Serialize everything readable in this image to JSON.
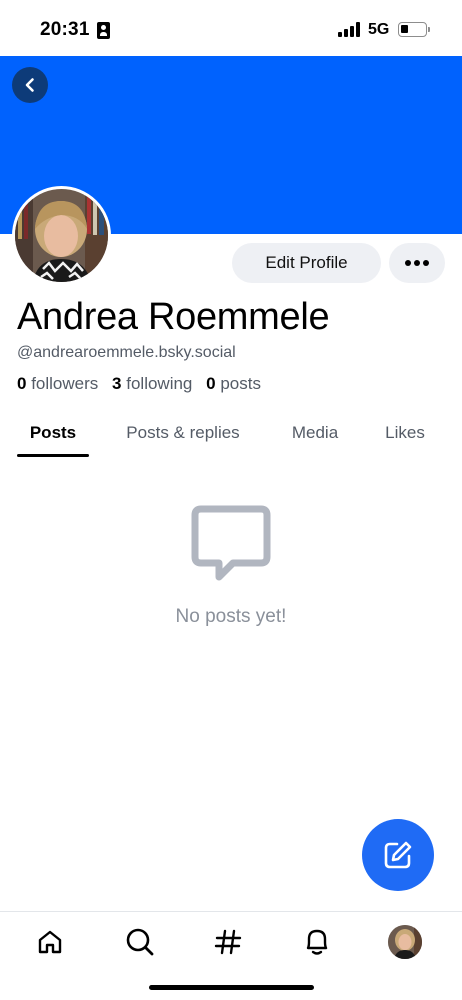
{
  "status_bar": {
    "time": "20:31",
    "network": "5G",
    "battery_level": 0.25
  },
  "profile": {
    "display_name": "Andrea Roemmele",
    "handle": "@andrearoemmele.bsky.social",
    "stats": {
      "followers_count": "0",
      "followers_label": "followers",
      "following_count": "3",
      "following_label": "following",
      "posts_count": "0",
      "posts_label": "posts"
    },
    "edit_profile_label": "Edit Profile",
    "banner_color": "#0062fe"
  },
  "tabs": [
    {
      "label": "Posts",
      "active": true
    },
    {
      "label": "Posts & replies",
      "active": false
    },
    {
      "label": "Media",
      "active": false
    },
    {
      "label": "Likes",
      "active": false
    }
  ],
  "empty_state": {
    "icon": "message-bubble-icon",
    "text": "No posts yet!"
  },
  "compose": {
    "icon": "compose-icon",
    "color": "#1f6bf5"
  },
  "bottom_nav": [
    {
      "icon": "home-icon"
    },
    {
      "icon": "search-icon"
    },
    {
      "icon": "hashtag-icon"
    },
    {
      "icon": "notifications-bell-icon"
    },
    {
      "icon": "profile-avatar"
    }
  ]
}
